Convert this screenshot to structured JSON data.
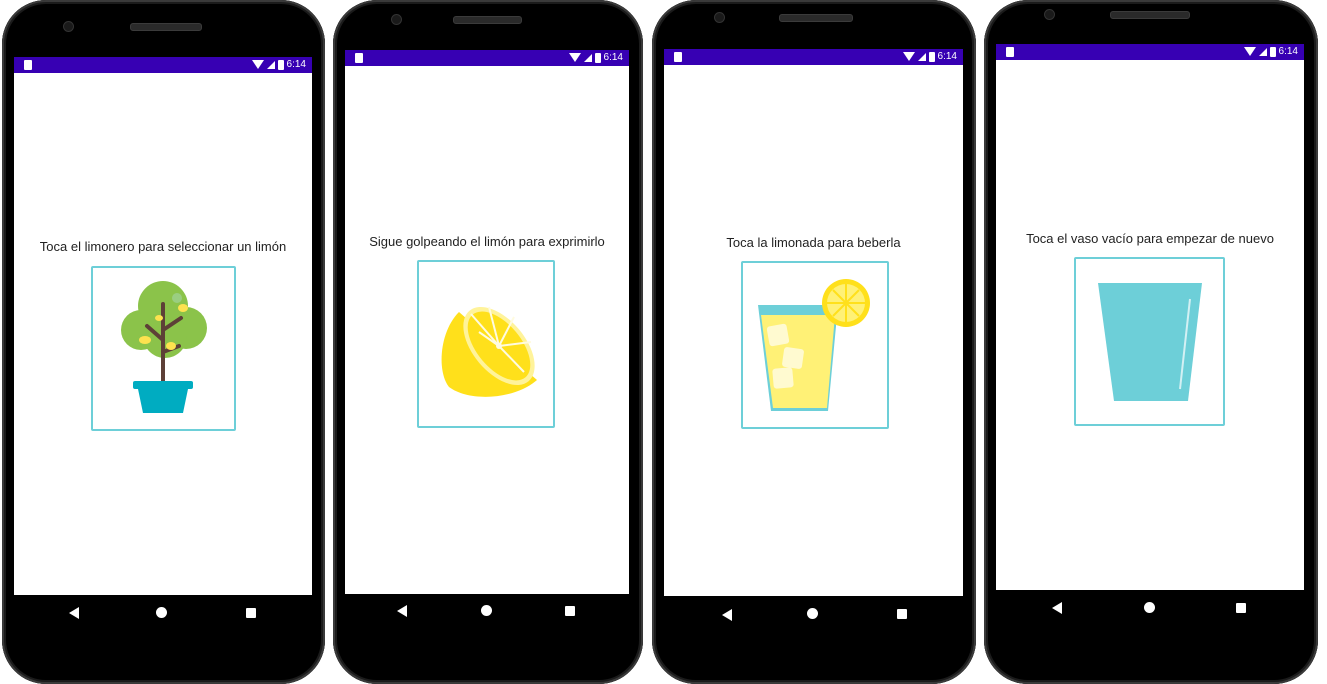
{
  "status_bar": {
    "time": "6:14",
    "icons": [
      "sd-card-icon",
      "wifi-icon",
      "signal-icon",
      "battery-icon"
    ],
    "color": "#3700b3"
  },
  "screens": [
    {
      "prompt": "Toca el limonero para seleccionar un limón",
      "image": "lemon-tree-icon"
    },
    {
      "prompt": "Sigue golpeando el limón para exprimirlo",
      "image": "squeezed-lemon-icon"
    },
    {
      "prompt": "Toca la limonada para beberla",
      "image": "lemonade-glass-icon"
    },
    {
      "prompt": "Toca el vaso vacío para empezar de nuevo",
      "image": "empty-glass-icon"
    }
  ],
  "navigation": {
    "buttons": [
      "back-icon",
      "home-icon",
      "recents-icon"
    ]
  },
  "colors": {
    "accent_border": "#6dcfd8",
    "tree_leaves": "#8bc34a",
    "pot": "#00acc1",
    "lemon": "#ffe01b",
    "glass": "#6dcfd8"
  }
}
